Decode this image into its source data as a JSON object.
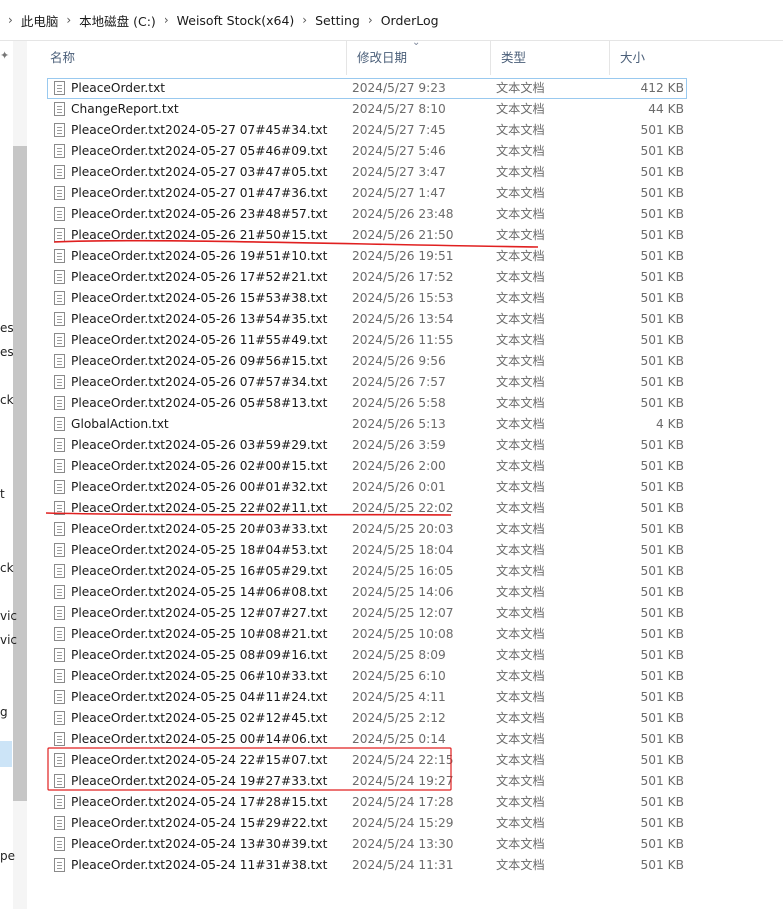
{
  "breadcrumb": {
    "parts": [
      "此电脑",
      "本地磁盘 (C:)",
      "Weisoft Stock(x64)",
      "Setting",
      "OrderLog"
    ]
  },
  "navpane": {
    "fragments": [
      "es",
      "es",
      "ck",
      "t",
      "ck",
      "vic",
      "vic",
      "g",
      "pe"
    ]
  },
  "columns": {
    "name": "名称",
    "date": "修改日期",
    "type": "类型",
    "size": "大小"
  },
  "files": [
    {
      "name": "PleaceOrder.txt",
      "date": "2024/5/27 9:23",
      "type": "文本文档",
      "size": "412 KB"
    },
    {
      "name": "ChangeReport.txt",
      "date": "2024/5/27 8:10",
      "type": "文本文档",
      "size": "44 KB"
    },
    {
      "name": "PleaceOrder.txt2024-05-27 07#45#34.txt",
      "date": "2024/5/27 7:45",
      "type": "文本文档",
      "size": "501 KB"
    },
    {
      "name": "PleaceOrder.txt2024-05-27 05#46#09.txt",
      "date": "2024/5/27 5:46",
      "type": "文本文档",
      "size": "501 KB"
    },
    {
      "name": "PleaceOrder.txt2024-05-27 03#47#05.txt",
      "date": "2024/5/27 3:47",
      "type": "文本文档",
      "size": "501 KB"
    },
    {
      "name": "PleaceOrder.txt2024-05-27 01#47#36.txt",
      "date": "2024/5/27 1:47",
      "type": "文本文档",
      "size": "501 KB"
    },
    {
      "name": "PleaceOrder.txt2024-05-26 23#48#57.txt",
      "date": "2024/5/26 23:48",
      "type": "文本文档",
      "size": "501 KB"
    },
    {
      "name": "PleaceOrder.txt2024-05-26 21#50#15.txt",
      "date": "2024/5/26 21:50",
      "type": "文本文档",
      "size": "501 KB"
    },
    {
      "name": "PleaceOrder.txt2024-05-26 19#51#10.txt",
      "date": "2024/5/26 19:51",
      "type": "文本文档",
      "size": "501 KB"
    },
    {
      "name": "PleaceOrder.txt2024-05-26 17#52#21.txt",
      "date": "2024/5/26 17:52",
      "type": "文本文档",
      "size": "501 KB"
    },
    {
      "name": "PleaceOrder.txt2024-05-26 15#53#38.txt",
      "date": "2024/5/26 15:53",
      "type": "文本文档",
      "size": "501 KB"
    },
    {
      "name": "PleaceOrder.txt2024-05-26 13#54#35.txt",
      "date": "2024/5/26 13:54",
      "type": "文本文档",
      "size": "501 KB"
    },
    {
      "name": "PleaceOrder.txt2024-05-26 11#55#49.txt",
      "date": "2024/5/26 11:55",
      "type": "文本文档",
      "size": "501 KB"
    },
    {
      "name": "PleaceOrder.txt2024-05-26 09#56#15.txt",
      "date": "2024/5/26 9:56",
      "type": "文本文档",
      "size": "501 KB"
    },
    {
      "name": "PleaceOrder.txt2024-05-26 07#57#34.txt",
      "date": "2024/5/26 7:57",
      "type": "文本文档",
      "size": "501 KB"
    },
    {
      "name": "PleaceOrder.txt2024-05-26 05#58#13.txt",
      "date": "2024/5/26 5:58",
      "type": "文本文档",
      "size": "501 KB"
    },
    {
      "name": "GlobalAction.txt",
      "date": "2024/5/26 5:13",
      "type": "文本文档",
      "size": "4 KB"
    },
    {
      "name": "PleaceOrder.txt2024-05-26 03#59#29.txt",
      "date": "2024/5/26 3:59",
      "type": "文本文档",
      "size": "501 KB"
    },
    {
      "name": "PleaceOrder.txt2024-05-26 02#00#15.txt",
      "date": "2024/5/26 2:00",
      "type": "文本文档",
      "size": "501 KB"
    },
    {
      "name": "PleaceOrder.txt2024-05-26 00#01#32.txt",
      "date": "2024/5/26 0:01",
      "type": "文本文档",
      "size": "501 KB"
    },
    {
      "name": "PleaceOrder.txt2024-05-25 22#02#11.txt",
      "date": "2024/5/25 22:02",
      "type": "文本文档",
      "size": "501 KB"
    },
    {
      "name": "PleaceOrder.txt2024-05-25 20#03#33.txt",
      "date": "2024/5/25 20:03",
      "type": "文本文档",
      "size": "501 KB"
    },
    {
      "name": "PleaceOrder.txt2024-05-25 18#04#53.txt",
      "date": "2024/5/25 18:04",
      "type": "文本文档",
      "size": "501 KB"
    },
    {
      "name": "PleaceOrder.txt2024-05-25 16#05#29.txt",
      "date": "2024/5/25 16:05",
      "type": "文本文档",
      "size": "501 KB"
    },
    {
      "name": "PleaceOrder.txt2024-05-25 14#06#08.txt",
      "date": "2024/5/25 14:06",
      "type": "文本文档",
      "size": "501 KB"
    },
    {
      "name": "PleaceOrder.txt2024-05-25 12#07#27.txt",
      "date": "2024/5/25 12:07",
      "type": "文本文档",
      "size": "501 KB"
    },
    {
      "name": "PleaceOrder.txt2024-05-25 10#08#21.txt",
      "date": "2024/5/25 10:08",
      "type": "文本文档",
      "size": "501 KB"
    },
    {
      "name": "PleaceOrder.txt2024-05-25 08#09#16.txt",
      "date": "2024/5/25 8:09",
      "type": "文本文档",
      "size": "501 KB"
    },
    {
      "name": "PleaceOrder.txt2024-05-25 06#10#33.txt",
      "date": "2024/5/25 6:10",
      "type": "文本文档",
      "size": "501 KB"
    },
    {
      "name": "PleaceOrder.txt2024-05-25 04#11#24.txt",
      "date": "2024/5/25 4:11",
      "type": "文本文档",
      "size": "501 KB"
    },
    {
      "name": "PleaceOrder.txt2024-05-25 02#12#45.txt",
      "date": "2024/5/25 2:12",
      "type": "文本文档",
      "size": "501 KB"
    },
    {
      "name": "PleaceOrder.txt2024-05-25 00#14#06.txt",
      "date": "2024/5/25 0:14",
      "type": "文本文档",
      "size": "501 KB"
    },
    {
      "name": "PleaceOrder.txt2024-05-24 22#15#07.txt",
      "date": "2024/5/24 22:15",
      "type": "文本文档",
      "size": "501 KB"
    },
    {
      "name": "PleaceOrder.txt2024-05-24 19#27#33.txt",
      "date": "2024/5/24 19:27",
      "type": "文本文档",
      "size": "501 KB"
    },
    {
      "name": "PleaceOrder.txt2024-05-24 17#28#15.txt",
      "date": "2024/5/24 17:28",
      "type": "文本文档",
      "size": "501 KB"
    },
    {
      "name": "PleaceOrder.txt2024-05-24 15#29#22.txt",
      "date": "2024/5/24 15:29",
      "type": "文本文档",
      "size": "501 KB"
    },
    {
      "name": "PleaceOrder.txt2024-05-24 13#30#39.txt",
      "date": "2024/5/24 13:30",
      "type": "文本文档",
      "size": "501 KB"
    },
    {
      "name": "PleaceOrder.txt2024-05-24 11#31#38.txt",
      "date": "2024/5/24 11:31",
      "type": "文本文档",
      "size": "501 KB"
    }
  ],
  "selection_index": 0,
  "colors": {
    "annotation": "#e02020",
    "selection_border": "#99c9ef",
    "header_text": "#4c607a"
  }
}
